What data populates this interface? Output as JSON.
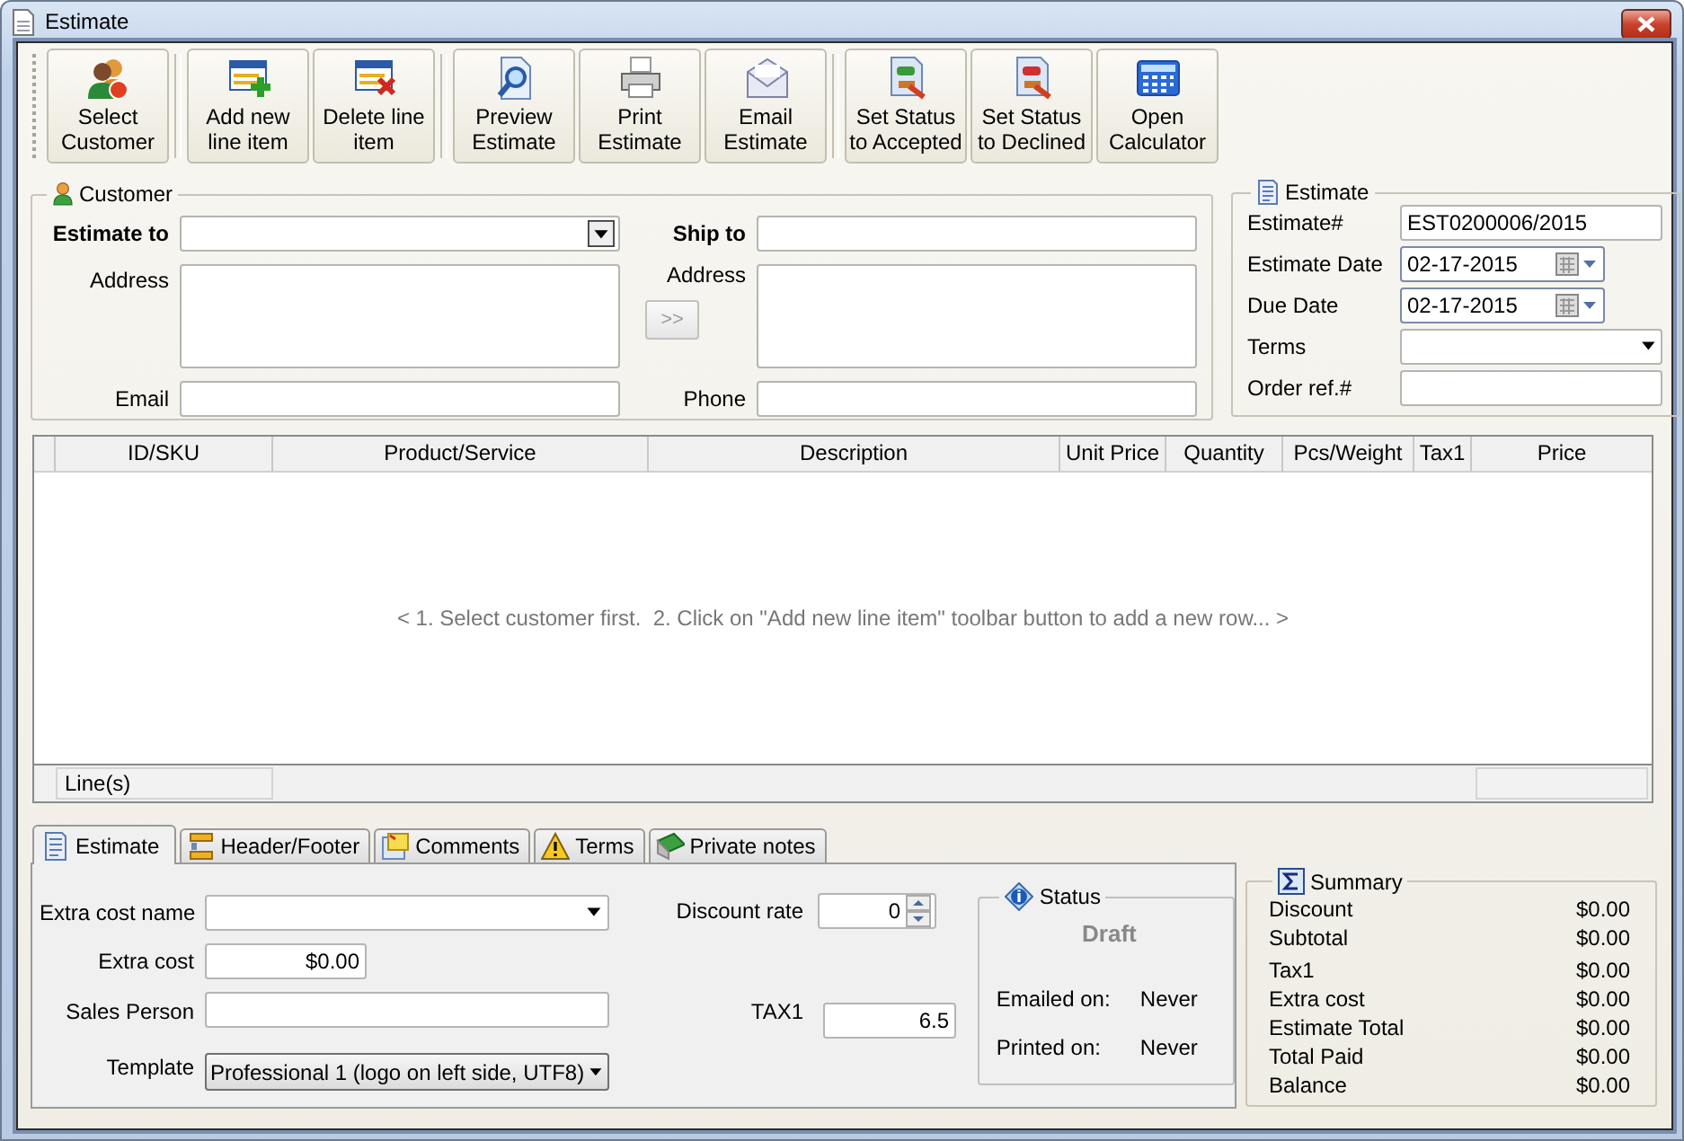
{
  "window": {
    "title": "Estimate"
  },
  "toolbar": {
    "groups": [
      [
        {
          "label": "Select\nCustomer"
        }
      ],
      [
        {
          "label": "Add new\nline item"
        },
        {
          "label": "Delete line\nitem"
        }
      ],
      [
        {
          "label": "Preview\nEstimate"
        },
        {
          "label": "Print\nEstimate"
        },
        {
          "label": "Email\nEstimate"
        }
      ],
      [
        {
          "label": "Set Status\nto Accepted"
        },
        {
          "label": "Set Status\nto Declined"
        },
        {
          "label": "Open\nCalculator"
        }
      ]
    ]
  },
  "customer": {
    "title": "Customer",
    "bill": [
      {
        "label": "Estimate to",
        "kind": "combo"
      },
      {
        "label": "Address",
        "kind": "memo"
      },
      {
        "label": "Email",
        "kind": "text"
      }
    ],
    "copy_button": {
      "label": ">>",
      "disabled": true
    },
    "ship": [
      {
        "label": "Ship to",
        "kind": "text"
      },
      {
        "label": "Address",
        "kind": "memo"
      },
      {
        "label": "Phone",
        "kind": "text"
      }
    ]
  },
  "estimate": {
    "title": "Estimate",
    "fields": [
      {
        "label": "Estimate#",
        "kind": "text",
        "value": "EST0200006/2015"
      },
      {
        "label": "Estimate Date",
        "kind": "date",
        "value": "02-17-2015"
      },
      {
        "label": "Due Date",
        "kind": "date",
        "value": "02-17-2015"
      },
      {
        "label": "Terms",
        "kind": "dropdown"
      },
      {
        "label": "Order ref.#",
        "kind": "text"
      }
    ]
  },
  "table": {
    "columns": [
      "ID/SKU",
      "Product/Service",
      "Description",
      "Unit Price",
      "Quantity",
      "Pcs/Weight",
      "Tax1",
      "Price"
    ],
    "empty_message": "< 1. Select customer first.  2. Click on \"Add new line item\" toolbar button to add a new row... >",
    "footer": "Line(s)"
  },
  "tabs": [
    {
      "label": "Estimate",
      "selected": true
    },
    {
      "label": "Header/Footer",
      "selected": false
    },
    {
      "label": "Comments",
      "selected": false
    },
    {
      "label": "Terms",
      "selected": false
    },
    {
      "label": "Private notes",
      "selected": false
    }
  ],
  "details": {
    "fields": [
      {
        "label": "Extra cost name",
        "kind": "dropdown"
      },
      {
        "label": "Extra cost",
        "kind": "money",
        "value": "$0.00"
      },
      {
        "label": "Sales Person",
        "kind": "text"
      },
      {
        "label": "Template",
        "kind": "select",
        "value": "Professional 1 (logo on left side, UTF8)"
      }
    ],
    "discount": {
      "label": "Discount rate",
      "value": "0"
    },
    "tax": {
      "label": "TAX1",
      "value": "6.5"
    }
  },
  "status": {
    "title": "Status",
    "value": "Draft",
    "rows": [
      {
        "label": "Emailed on:",
        "value": "Never"
      },
      {
        "label": "Printed on:",
        "value": "Never"
      }
    ]
  },
  "summary": {
    "title": "Summary",
    "rows": [
      {
        "label": "Discount",
        "value": "$0.00"
      },
      {
        "label": "Subtotal",
        "value": "$0.00"
      },
      {
        "label": "Tax1",
        "value": "$0.00"
      },
      {
        "label": "Extra cost",
        "value": "$0.00"
      },
      {
        "label": "Estimate Total",
        "value": "$0.00"
      },
      {
        "label": "Total Paid",
        "value": "$0.00"
      },
      {
        "label": "Balance",
        "value": "$0.00"
      }
    ]
  }
}
